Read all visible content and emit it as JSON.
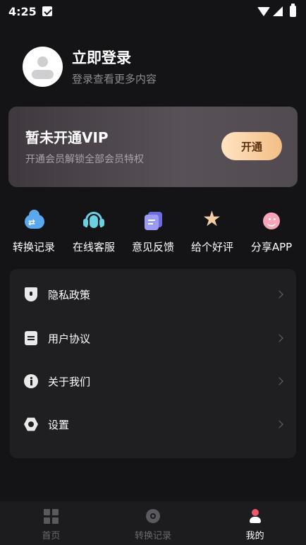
{
  "status_bar": {
    "time": "4:25",
    "icons": [
      "sim-icon",
      "wifi-icon",
      "signal-icon",
      "battery-icon"
    ]
  },
  "profile": {
    "title": "立即登录",
    "subtitle": "登录查看更多内容",
    "avatar_icon": "avatar-icon"
  },
  "vip": {
    "title": "暂未开通VIP",
    "subtitle": "开通会员解锁全部会员特权",
    "button": "开通",
    "button_gradient": [
      "#ffe3c2",
      "#f3bf86"
    ]
  },
  "quick_actions": [
    {
      "label": "转换记录",
      "icon": "cloud-transfer-icon",
      "color": "#5aa9f0"
    },
    {
      "label": "在线客服",
      "icon": "headset-icon",
      "color": "#6bd0e4"
    },
    {
      "label": "意见反馈",
      "icon": "feedback-document-icon",
      "color": "#9b9bf5"
    },
    {
      "label": "给个好评",
      "icon": "star-icon",
      "color": "#f4cda0"
    },
    {
      "label": "分享APP",
      "icon": "smile-icon",
      "color": "#f6a6b8"
    }
  ],
  "menu": [
    {
      "label": "隐私政策",
      "icon": "shield-icon"
    },
    {
      "label": "用户协议",
      "icon": "document-icon"
    },
    {
      "label": "关于我们",
      "icon": "info-icon"
    },
    {
      "label": "设置",
      "icon": "gear-icon"
    }
  ],
  "bottom_nav": {
    "tabs": [
      {
        "label": "首页",
        "icon": "home-grid-icon",
        "active": false
      },
      {
        "label": "转换记录",
        "icon": "record-icon",
        "active": false
      },
      {
        "label": "我的",
        "icon": "user-icon",
        "active": true
      }
    ]
  },
  "colors": {
    "background": "#141416",
    "card": "#1f1f22",
    "accent_active": "#f0556b"
  }
}
